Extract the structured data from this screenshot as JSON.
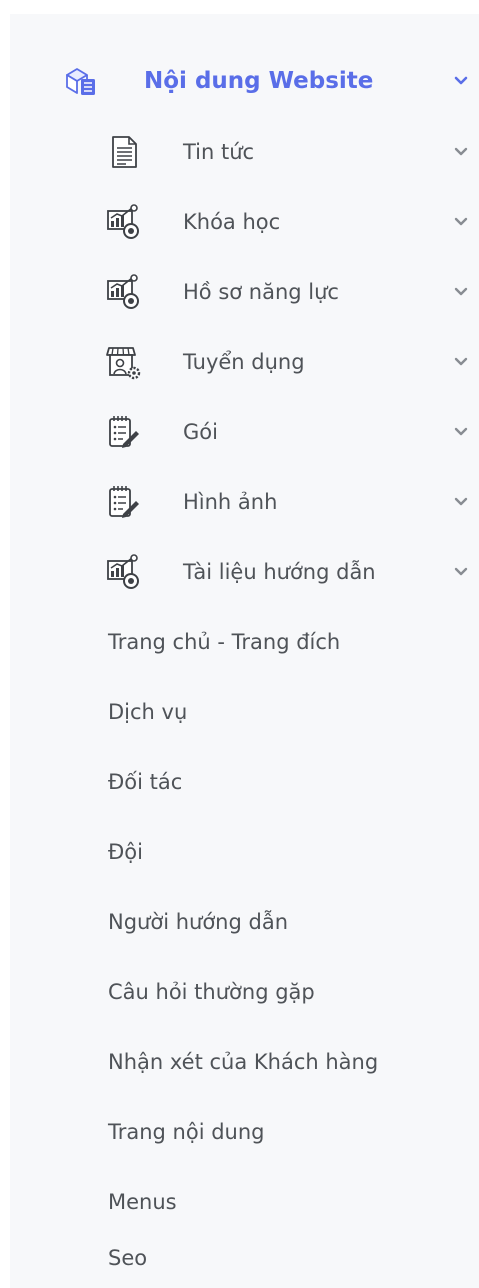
{
  "menu": {
    "parent": {
      "label": "Nội dung Website",
      "icon": "box-document-icon",
      "accent_color": "#5a6ee8"
    },
    "children": [
      {
        "label": "Tin tức",
        "icon": "document-icon"
      },
      {
        "label": "Khóa học",
        "icon": "chart-gear-icon"
      },
      {
        "label": "Hồ sơ năng lực",
        "icon": "chart-gear-icon"
      },
      {
        "label": "Tuyển dụng",
        "icon": "shop-person-icon"
      },
      {
        "label": "Gói",
        "icon": "notepad-pen-icon"
      },
      {
        "label": "Hình ảnh",
        "icon": "notepad-pen-icon"
      },
      {
        "label": "Tài liệu hướng dẫn",
        "icon": "chart-gear-icon"
      }
    ],
    "links": [
      {
        "label": "Trang chủ - Trang đích"
      },
      {
        "label": "Dịch vụ"
      },
      {
        "label": "Đối tác"
      },
      {
        "label": "Đội"
      },
      {
        "label": "Người hướng dẫn"
      },
      {
        "label": "Câu hỏi thường gặp"
      },
      {
        "label": "Nhận xét của Khách hàng"
      },
      {
        "label": "Trang nội dung"
      },
      {
        "label": "Menus"
      },
      {
        "label": "Seo"
      }
    ]
  }
}
